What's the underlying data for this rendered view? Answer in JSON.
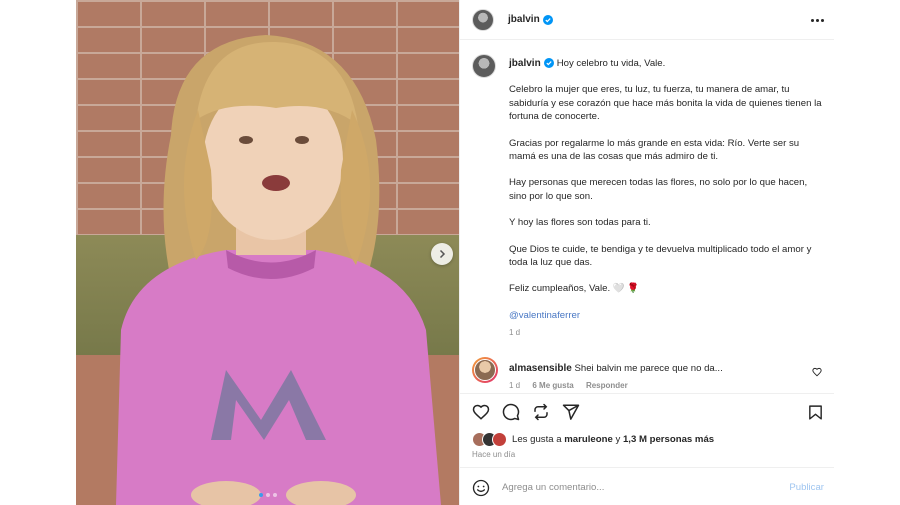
{
  "post": {
    "username": "jbalvin",
    "caption_first": "Hoy celebro tu vida, Vale.",
    "paragraphs": [
      "Celebro la mujer que eres, tu luz, tu fuerza, tu manera de amar, tu sabiduría y ese corazón que hace más bonita la vida de quienes tienen la fortuna de conocerte.",
      "Gracias por regalarme lo más grande en esta vida: Río. Verte ser su mamá es una de las cosas que más admiro de ti.",
      "Hay personas que merecen todas las flores, no solo por lo que hacen, sino por lo que son.",
      "Y hoy las flores son todas para ti.",
      "Que Dios te cuide, te bendiga y te devuelva multiplicado todo el amor y toda la luz que das.",
      "Feliz cumpleaños, Vale. 🤍 🌹"
    ],
    "mention": "@valentinaferrer",
    "caption_time": "1 d"
  },
  "comment": {
    "username": "almasensible",
    "text": "Shei balvin me parece que no da...",
    "time": "1 d",
    "likes": "6 Me gusta",
    "reply": "Responder"
  },
  "likes": {
    "prefix": "Les gusta a",
    "user": "maruleone",
    "joiner": "y",
    "count": "1,3 M personas más"
  },
  "time_ago": "Hace un día",
  "add_comment": {
    "placeholder": "Agrega un comentario...",
    "publish": "Publicar"
  },
  "icons": [
    "verified-badge",
    "more-icon",
    "chevron-right-icon",
    "heart-icon",
    "comment-icon",
    "share-icon",
    "send-icon",
    "save-icon",
    "emoji-icon"
  ],
  "colors": {
    "accent": "#0095f6",
    "verified": "#0095f6",
    "muted": "#8e8e8e"
  }
}
